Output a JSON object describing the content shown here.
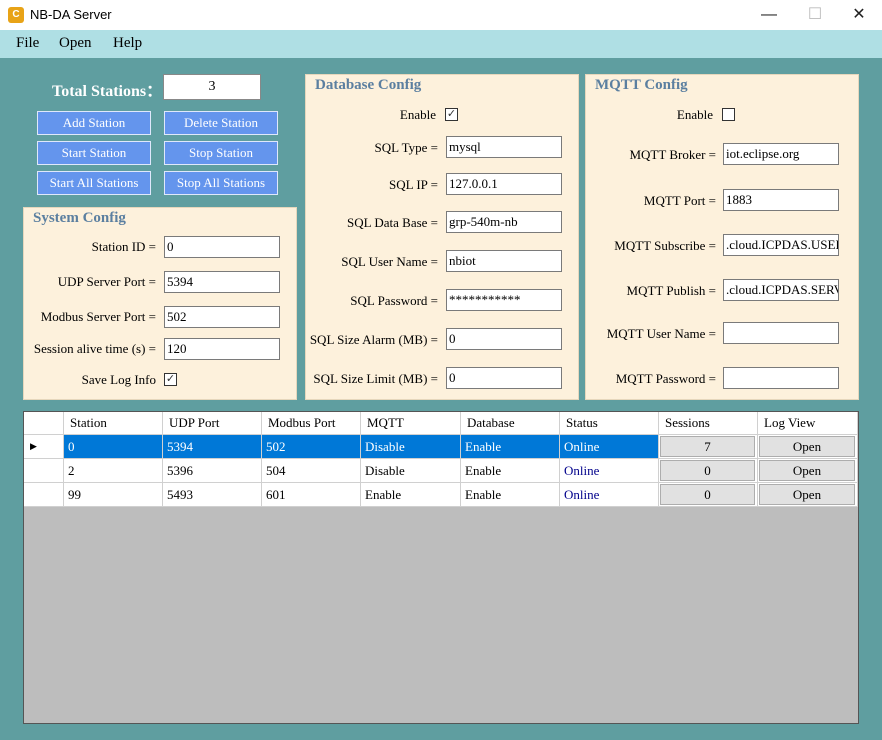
{
  "window": {
    "title": "NB-DA Server",
    "icon_text": "C",
    "minimize": "—",
    "maximize": "☐",
    "close": "✕"
  },
  "menu": [
    "File",
    "Open",
    "Help"
  ],
  "total": {
    "label": "Total Stations：",
    "value": "3"
  },
  "buttons": {
    "add": "Add Station",
    "delete": "Delete Station",
    "start": "Start Station",
    "stop": "Stop Station",
    "start_all": "Start All Stations",
    "stop_all": "Stop All Stations"
  },
  "system_config": {
    "title": "System Config",
    "station_id_label": "Station ID =",
    "station_id": "0",
    "udp_port_label": "UDP Server Port =",
    "udp_port": "5394",
    "modbus_port_label": "Modbus Server Port =",
    "modbus_port": "502",
    "session_label": "Session alive time (s) =",
    "session": "120",
    "save_log_label": "Save Log Info",
    "save_log_checked": "✓"
  },
  "database_config": {
    "title": "Database Config",
    "enable_label": "Enable",
    "enable_checked": "✓",
    "sql_type_label": "SQL Type =",
    "sql_type": "mysql",
    "sql_ip_label": "SQL IP =",
    "sql_ip": "127.0.0.1",
    "sql_db_label": "SQL Data Base =",
    "sql_db": "grp-540m-nb",
    "sql_user_label": "SQL User Name =",
    "sql_user": "nbiot",
    "sql_pass_label": "SQL Password =",
    "sql_pass": "***********",
    "sql_alarm_label": "SQL Size Alarm (MB) =",
    "sql_alarm": "0",
    "sql_limit_label": "SQL Size Limit (MB) =",
    "sql_limit": "0"
  },
  "mqtt_config": {
    "title": "MQTT Config",
    "enable_label": "Enable",
    "enable_checked": "",
    "broker_label": "MQTT Broker =",
    "broker": "iot.eclipse.org",
    "port_label": "MQTT Port =",
    "port": "1883",
    "subscribe_label": "MQTT Subscribe =",
    "subscribe": ".cloud.ICPDAS.USEI",
    "publish_label": "MQTT Publish =",
    "publish": ".cloud.ICPDAS.SERV",
    "user_label": "MQTT User Name =",
    "user": "",
    "password_label": "MQTT  Password =",
    "password": ""
  },
  "table": {
    "columns": [
      "Station",
      "UDP Port",
      "Modbus Port",
      "MQTT",
      "Database",
      "Status",
      "Sessions",
      "Log View"
    ],
    "current_row_marker": "▶",
    "rows": [
      {
        "station": "0",
        "udp": "5394",
        "modbus": "502",
        "mqtt": "Disable",
        "database": "Enable",
        "status": "Online",
        "sessions": "7",
        "log": "Open"
      },
      {
        "station": "2",
        "udp": "5396",
        "modbus": "504",
        "mqtt": "Disable",
        "database": "Enable",
        "status": "Online",
        "sessions": "0",
        "log": "Open"
      },
      {
        "station": "99",
        "udp": "5493",
        "modbus": "601",
        "mqtt": "Enable",
        "database": "Enable",
        "status": "Online",
        "sessions": "0",
        "log": "Open"
      }
    ]
  },
  "colors": {
    "client_bg": "#5f9ea0",
    "menu_bg": "#afdfe4",
    "panel_bg": "#fdf1dc",
    "button_bg": "#6495ed",
    "selection": "#0078d7",
    "online_text": "#00008b"
  }
}
